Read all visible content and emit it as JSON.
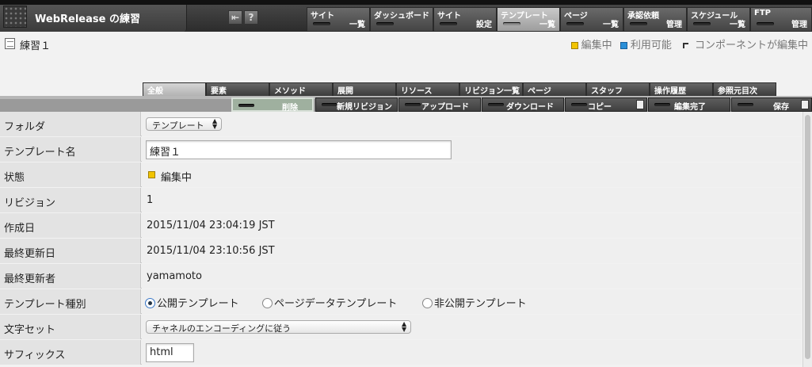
{
  "app": {
    "title": "WebRelease の練習"
  },
  "nav": [
    {
      "line1": "サイト",
      "line2": "一覧",
      "active": false
    },
    {
      "line1": "ダッシュボード",
      "line2": "",
      "active": false
    },
    {
      "line1": "サイト",
      "line2": "設定",
      "active": false
    },
    {
      "line1": "テンプレート",
      "line2": "一覧",
      "active": true
    },
    {
      "line1": "ページ",
      "line2": "一覧",
      "active": false
    },
    {
      "line1": "承認依頼",
      "line2": "管理",
      "active": false
    },
    {
      "line1": "スケジュール",
      "line2": "一覧",
      "active": false
    },
    {
      "line1": "FTP",
      "line2": "管理",
      "active": false
    }
  ],
  "page": {
    "title": "練習１"
  },
  "legend": {
    "editing": "編集中",
    "available": "利用可能",
    "component_editing": "コンポーネントが編集中"
  },
  "subtabs": [
    "全般",
    "要素",
    "メソッド",
    "展開",
    "リソース",
    "リビジョン一覧",
    "ページ",
    "スタッフ",
    "操作履歴",
    "参照元目次"
  ],
  "actions": [
    {
      "label": "削除",
      "active": true
    },
    {
      "label": "新規リビジョン",
      "active": false
    },
    {
      "label": "アップロード",
      "active": false
    },
    {
      "label": "ダウンロード",
      "active": false
    },
    {
      "label": "コピー",
      "active": false
    },
    {
      "label": "編集完了",
      "active": false
    },
    {
      "label": "保存",
      "active": false
    }
  ],
  "form": {
    "folder": {
      "label": "フォルダ",
      "value": "テンプレート"
    },
    "template_name": {
      "label": "テンプレート名",
      "value": "練習１"
    },
    "status": {
      "label": "状態",
      "value": "編集中"
    },
    "revision": {
      "label": "リビジョン",
      "value": "1"
    },
    "created": {
      "label": "作成日",
      "value": "2015/11/04 23:04:19 JST"
    },
    "updated": {
      "label": "最終更新日",
      "value": "2015/11/04 23:10:56 JST"
    },
    "updater": {
      "label": "最終更新者",
      "value": "yamamoto"
    },
    "template_type": {
      "label": "テンプレート種別",
      "options": [
        "公開テンプレート",
        "ページデータテンプレート",
        "非公開テンプレート"
      ],
      "selected": "公開テンプレート"
    },
    "charset": {
      "label": "文字セット",
      "value": "チャネルのエンコーディングに従う"
    },
    "suffix": {
      "label": "サフィックス",
      "value": "html"
    }
  },
  "colors": {
    "editing": "#f2c400",
    "available": "#2a8fd8"
  }
}
